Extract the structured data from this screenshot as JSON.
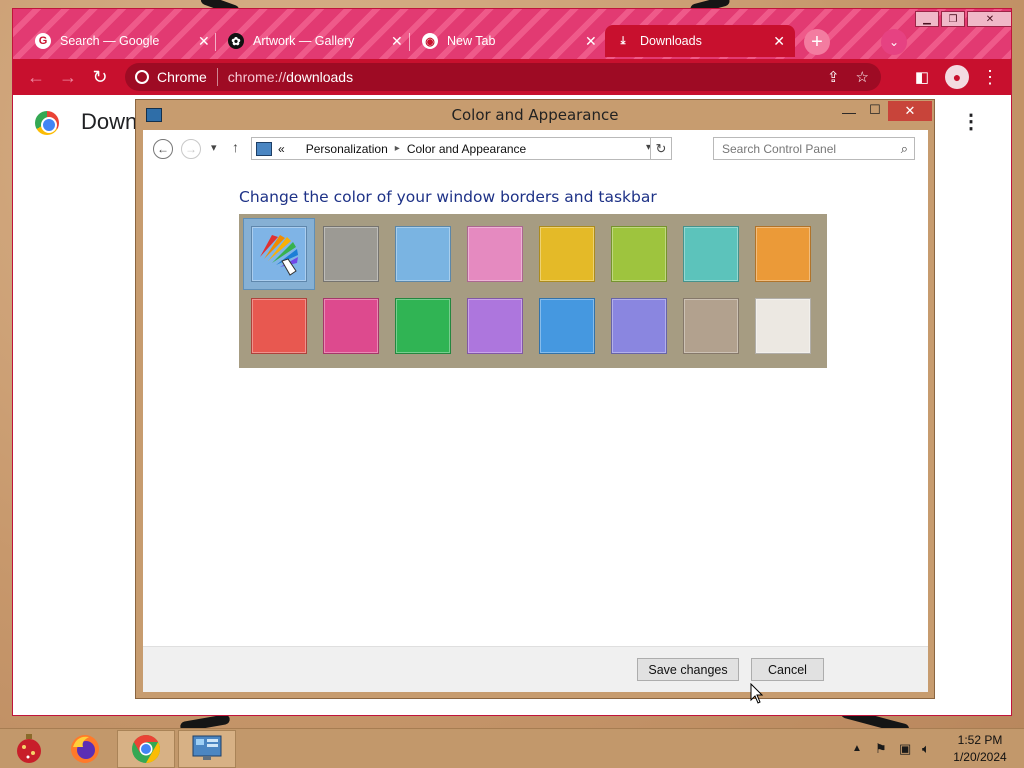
{
  "browser": {
    "tabs": [
      {
        "title": "Search — Google",
        "icon": "google-icon"
      },
      {
        "title": "Artwork — Gallery",
        "icon": "paw-icon"
      },
      {
        "title": "New Tab",
        "icon": "chrome-icon"
      },
      {
        "title": "Downloads",
        "icon": "download-icon"
      }
    ],
    "omnibox": {
      "site": "Chrome",
      "url_prefix": "chrome://",
      "url_path": "downloads"
    },
    "page_title": "Downloads"
  },
  "dialog": {
    "title": "Color and Appearance",
    "breadcrumb": [
      "Personalization",
      "Color and Appearance"
    ],
    "breadcrumb_overflow": "«",
    "search_placeholder": "Search Control Panel",
    "heading": "Change the color of your window borders and taskbar",
    "colors": [
      {
        "name": "automatic",
        "hex": "#6aa3d8",
        "selected": true
      },
      {
        "name": "gray",
        "hex": "#9c9a94"
      },
      {
        "name": "sky-blue",
        "hex": "#7ab4e2"
      },
      {
        "name": "pink",
        "hex": "#e58ac0"
      },
      {
        "name": "gold",
        "hex": "#e4ba28"
      },
      {
        "name": "lime",
        "hex": "#9ec43e"
      },
      {
        "name": "teal",
        "hex": "#5cc3bb"
      },
      {
        "name": "orange",
        "hex": "#eb9a38"
      },
      {
        "name": "red",
        "hex": "#e85850"
      },
      {
        "name": "magenta",
        "hex": "#dd4a8e"
      },
      {
        "name": "green",
        "hex": "#30b454"
      },
      {
        "name": "violet",
        "hex": "#ad76dd"
      },
      {
        "name": "blue",
        "hex": "#4598e0"
      },
      {
        "name": "periwinkle",
        "hex": "#8a86e0"
      },
      {
        "name": "taupe",
        "hex": "#b2a18e"
      },
      {
        "name": "off-white",
        "hex": "#ece8e2"
      }
    ],
    "save_label": "Save changes",
    "cancel_label": "Cancel"
  },
  "taskbar": {
    "apps": [
      "ornament-icon",
      "firefox-icon",
      "chrome-icon",
      "control-panel-icon"
    ],
    "time": "1:52 PM",
    "date": "1/20/2024"
  }
}
